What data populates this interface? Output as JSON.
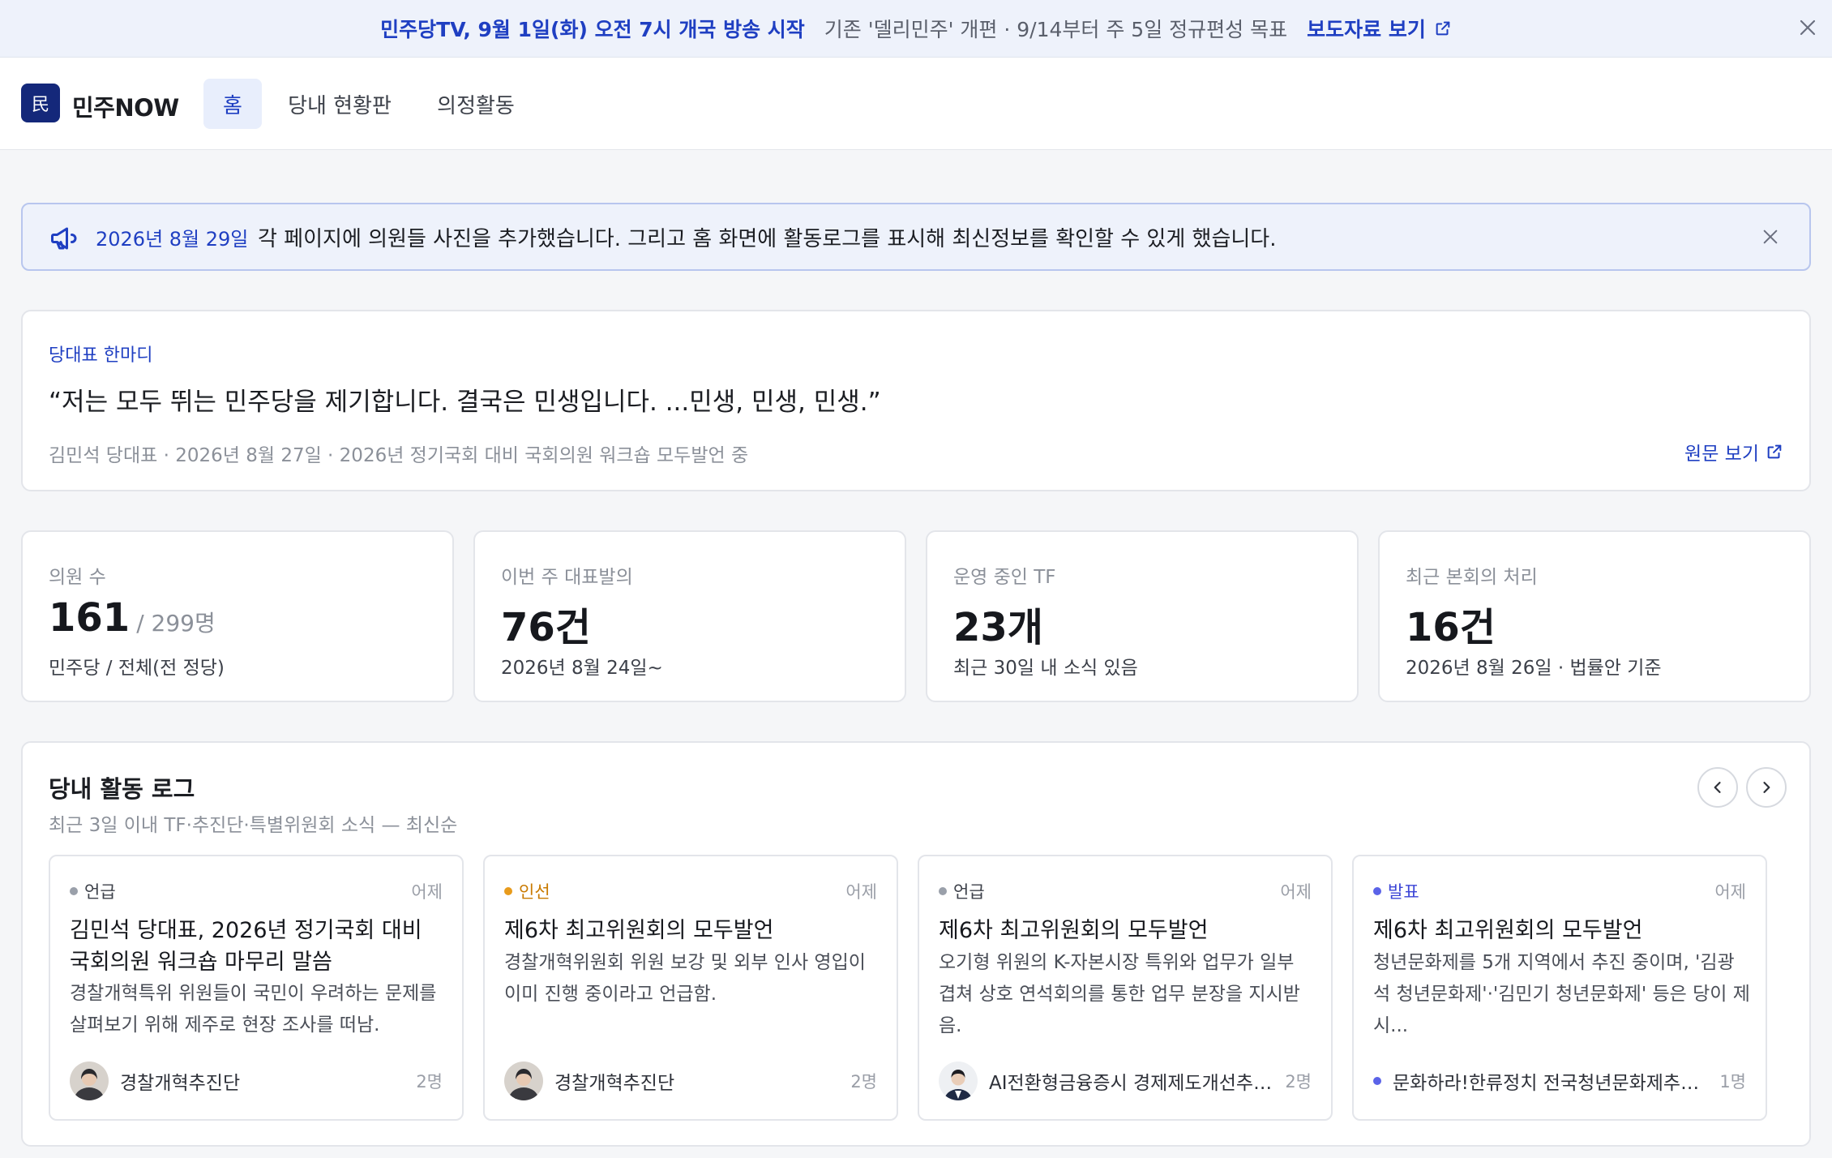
{
  "topbar": {
    "title": "민주당TV, 9월 1일(화) 오전 7시 개국 방송 시작",
    "description": "기존 '델리민주' 개편 · 9/14부터 주 5일 정규편성 목표",
    "link_label": "보도자료 보기",
    "link_icon": "external-link-icon",
    "close_icon": "close-icon"
  },
  "nav": {
    "logo_char": "民",
    "logo_text": "민주NOW",
    "tabs": [
      {
        "label": "홈",
        "active": true
      },
      {
        "label": "당내 현황판",
        "active": false
      },
      {
        "label": "의정활동",
        "active": false
      }
    ]
  },
  "notice": {
    "icon": "megaphone-icon",
    "date": "2026년 8월 29일",
    "text": "각 페이지에 의원들 사진을 추가했습니다. 그리고 홈 화면에 활동로그를 표시해 최신정보를 확인할 수 있게 했습니다.",
    "close_icon": "close-icon"
  },
  "quote": {
    "label": "당대표 한마디",
    "text": "“저는 모두 뛰는 민주당을 제기합니다. 결국은 민생입니다. ...민생, 민생, 민생.”",
    "meta": "김민석 당대표 · 2026년 8월 27일 · 2026년 정기국회 대비 국회의원 워크숍 모두발언 중",
    "link_label": "원문 보기"
  },
  "stats": [
    {
      "label": "의원 수",
      "value": "161",
      "total": "/ 299명",
      "sub": "민주당 / 전체(전 정당)"
    },
    {
      "label": "이번 주 대표발의",
      "value": "76건",
      "total": "",
      "sub": "2026년 8월 24일~"
    },
    {
      "label": "운영 중인 TF",
      "value": "23개",
      "total": "",
      "sub": "최근 30일 내 소식 있음"
    },
    {
      "label": "최근 본회의 처리",
      "value": "16건",
      "total": "",
      "sub": "2026년 8월 26일 · 법률안 기준"
    }
  ],
  "activity_log": {
    "title": "당내 활동 로그",
    "subtitle": "최근 3일 이내 TF·추진단·특별위원회 소식 — 최신순",
    "prev_icon": "chevron-left-icon",
    "next_icon": "chevron-right-icon",
    "cards": [
      {
        "tag": "언급",
        "tag_color": "#9aa0aa",
        "tag_text_color": "#3c4049",
        "when": "어제",
        "title": "김민석 당대표, 2026년 정기국회 대비 국회의원 워크숍 마무리 말씀",
        "body": "경찰개혁특위 위원들이 국민이 우려하는 문제를 살펴보기 위해 제주로 현장 조사를 떠남.",
        "org": "경찰개혁추진단",
        "count": "2명"
      },
      {
        "tag": "인선",
        "tag_color": "#e89b1c",
        "tag_text_color": "#c97a00",
        "when": "어제",
        "title": "제6차 최고위원회의 모두발언",
        "body": "경찰개혁위원회 위원 보강 및 외부 인사 영입이 이미 진행 중이라고 언급함.",
        "org": "경찰개혁추진단",
        "count": "2명"
      },
      {
        "tag": "언급",
        "tag_color": "#9aa0aa",
        "tag_text_color": "#3c4049",
        "when": "어제",
        "title": "제6차 최고위원회의 모두발언",
        "body": "오기형 위원의 K-자본시장 특위와 업무가 일부 겹쳐 상호 연석회의를 통한 업무 분장을 지시받음.",
        "org": "AI전환형금융증시 경제제도개선추진단",
        "count": "2명"
      },
      {
        "tag": "발표",
        "tag_color": "#5b63e8",
        "tag_text_color": "#3b44d6",
        "when": "어제",
        "title": "제6차 최고위원회의 모두발언",
        "body": "청년문화제를 5개 지역에서 추진 중이며, '김광석 청년문화제'·'김민기 청년문화제' 등은 당이 제시...",
        "org": "문화하라!한류정치 전국청년문화제추진단",
        "count": "1명"
      }
    ]
  },
  "colors": {
    "accent": "#1f3fc2",
    "logo_bg": "#14287a",
    "page_bg": "#f5f6f8"
  }
}
